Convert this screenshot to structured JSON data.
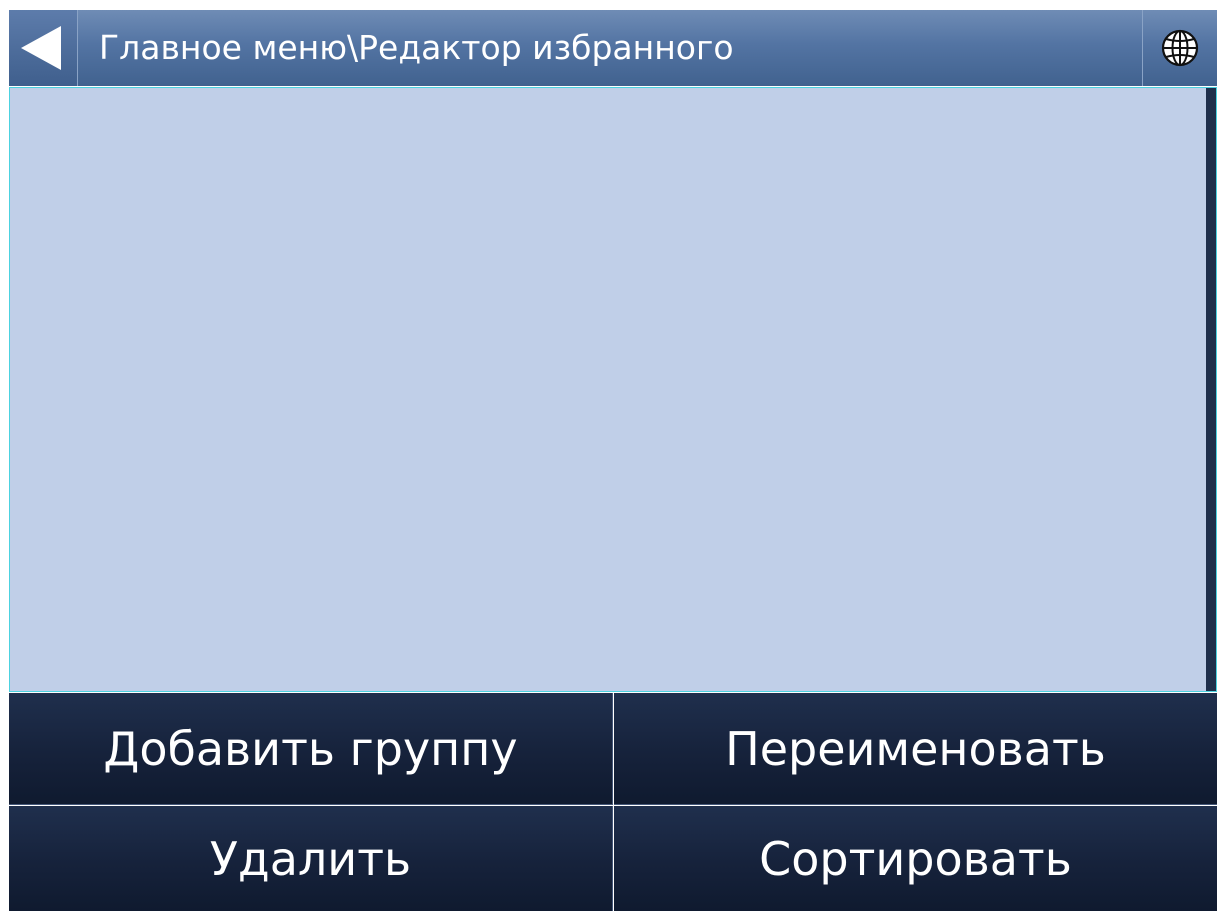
{
  "header": {
    "title": "Главное меню\\Редактор избранного",
    "back_icon": "back-arrow-icon",
    "globe_icon": "globe-icon"
  },
  "list": {
    "items": []
  },
  "buttons": {
    "add_group": "Добавить группу",
    "rename": "Переименовать",
    "delete": "Удалить",
    "sort": "Сортировать"
  },
  "colors": {
    "header": "#5374a3",
    "list_background": "#c0cfe8",
    "list_border": "#4cd2e0",
    "button_background": "#16223b"
  }
}
